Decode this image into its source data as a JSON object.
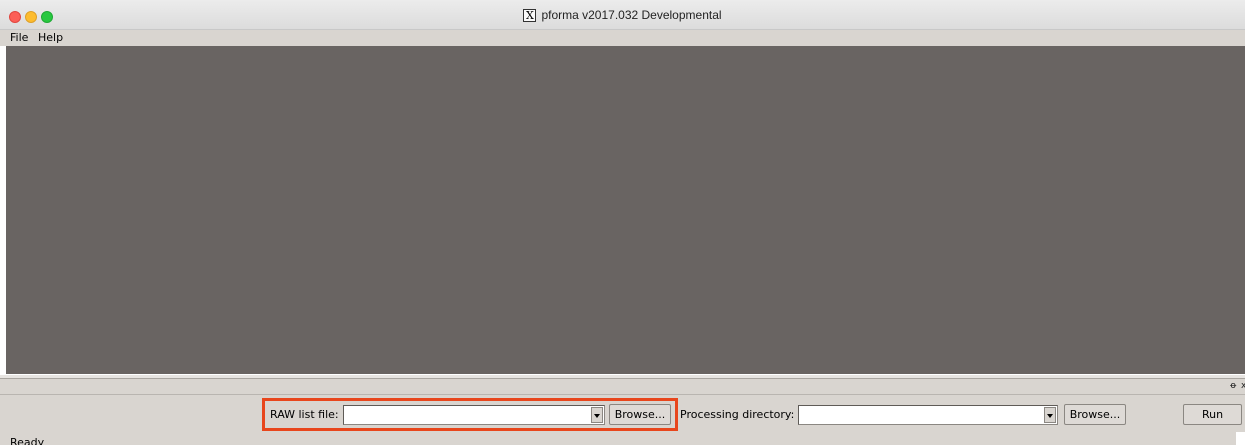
{
  "window": {
    "title": "pforma v2017.032 Developmental",
    "x_logo": "X"
  },
  "menu": {
    "items": [
      {
        "label": "File"
      },
      {
        "label": "Help"
      }
    ]
  },
  "dock": {
    "float_icon": "ᴟ",
    "float_glyph": "ꝋ",
    "close_glyph": "x"
  },
  "form": {
    "raw_list_label": "RAW list file:",
    "raw_list_value": "",
    "raw_browse_label": "Browse...",
    "processing_dir_label": "Processing directory:",
    "processing_dir_value": "",
    "processing_browse_label": "Browse...",
    "run_label": "Run"
  },
  "status": {
    "text": "Ready"
  },
  "colors": {
    "canvas": "#696462",
    "chrome": "#d9d5d0",
    "highlight": "#e8461c"
  }
}
